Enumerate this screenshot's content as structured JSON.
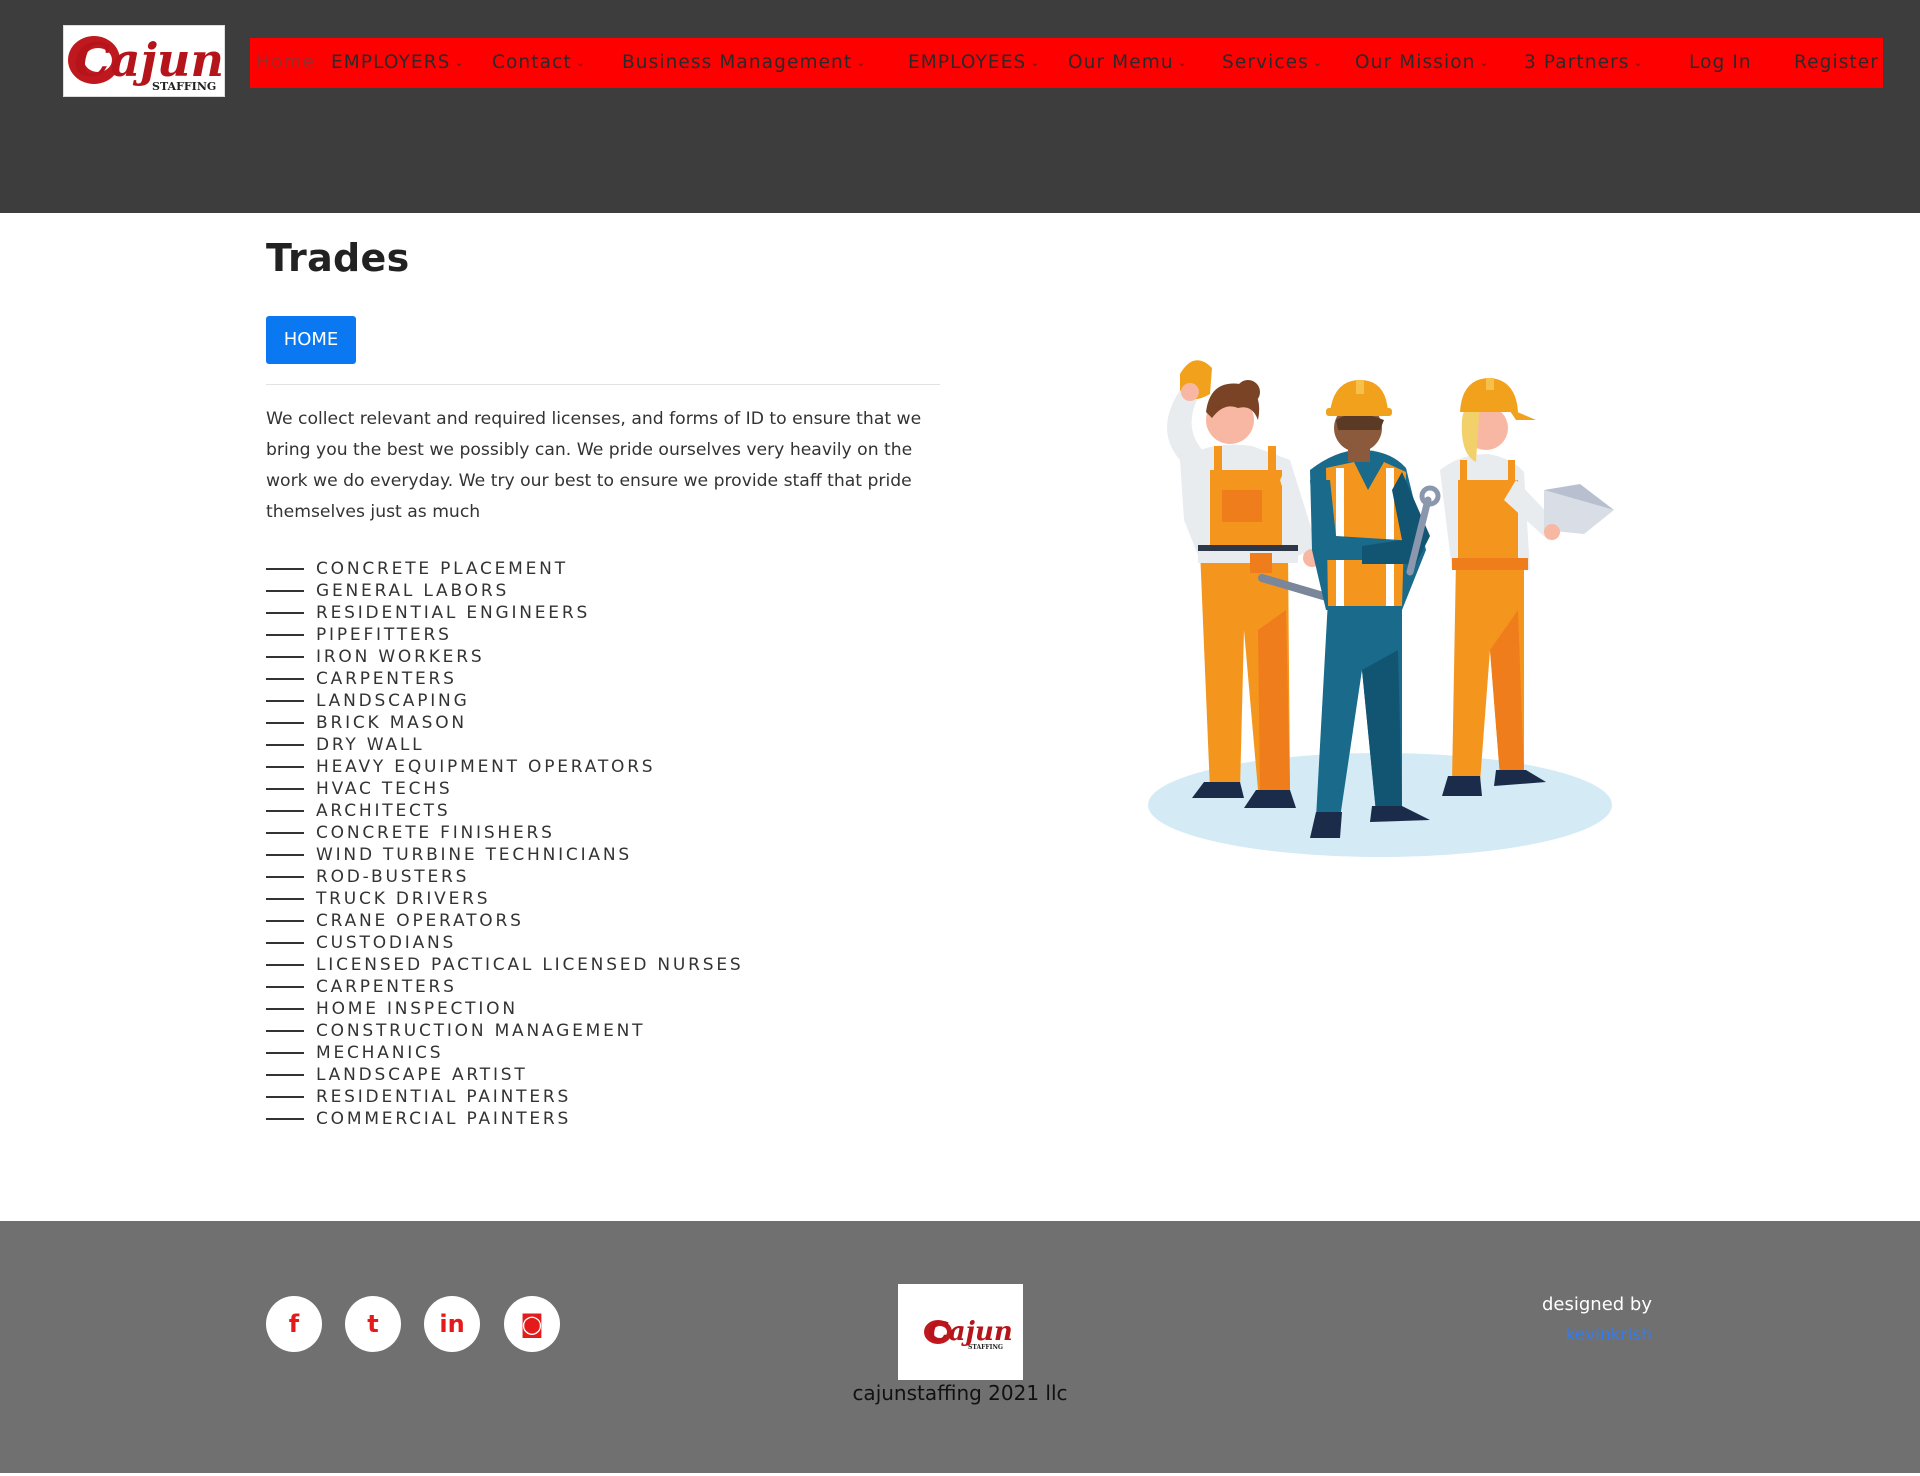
{
  "logo": {
    "main": "Cajun",
    "sub": "STAFFING"
  },
  "nav": {
    "items": [
      {
        "label": "Home",
        "dropdown": false
      },
      {
        "label": "EMPLOYERS",
        "dropdown": true
      },
      {
        "label": "Contact",
        "dropdown": true
      },
      {
        "label": "Business Management",
        "dropdown": true
      },
      {
        "label": "EMPLOYEES",
        "dropdown": true
      },
      {
        "label": "Our Memu",
        "dropdown": true
      },
      {
        "label": "Services",
        "dropdown": true
      },
      {
        "label": "Our Mission",
        "dropdown": true
      },
      {
        "label": "3 Partners",
        "dropdown": true
      },
      {
        "label": "Log In",
        "dropdown": false
      },
      {
        "label": "Register",
        "dropdown": false
      }
    ],
    "caret": "⌄"
  },
  "page": {
    "title": "Trades",
    "home_button": "HOME",
    "intro": "We collect relevant and required licenses, and forms of ID to ensure that we bring you the best we possibly can. We pride ourselves very heavily on the work we do everyday. We try our best to ensure we provide staff that pride themselves just as much",
    "trades": [
      "CONCRETE PLACEMENT",
      "GENERAL LABORS",
      "RESIDENTIAL ENGINEERS",
      "PIPEFITTERS",
      "IRON WORKERS",
      "CARPENTERS",
      "LANDSCAPING",
      "BRICK MASON",
      "DRY WALL",
      "HEAVY EQUIPMENT OPERATORS",
      "HVAC TECHS",
      "ARCHITECTS",
      "CONCRETE FINISHERS",
      "WIND TURBINE TECHNICIANS",
      "ROD-BUSTERS",
      "TRUCK DRIVERS",
      "CRANE OPERATORS",
      "CUSTODIANS",
      "LICENSED PACTICAL LICENSED NURSES",
      "CARPENTERS",
      "HOME INSPECTION",
      "CONSTRUCTION MANAGEMENT",
      "MECHANICS",
      "LANDSCAPE ARTIST",
      "RESIDENTIAL PAINTERS",
      "COMMERCIAL PAINTERS"
    ]
  },
  "footer": {
    "social": [
      {
        "name": "facebook",
        "glyph": "f"
      },
      {
        "name": "twitter",
        "glyph": "t"
      },
      {
        "name": "linkedin",
        "glyph": "in"
      },
      {
        "name": "instagram",
        "glyph": "◙"
      }
    ],
    "copyright": "cajunstaffing 2021 llc",
    "designed_by": "designed by",
    "designer": "kevinkrish"
  },
  "colors": {
    "header_bg": "#3d3d3d",
    "nav_bg": "#ff0000",
    "button_blue": "#0a78f0",
    "footer_bg": "#707070",
    "social_icon": "#e41b1b",
    "designer_link": "#2f7df5"
  }
}
